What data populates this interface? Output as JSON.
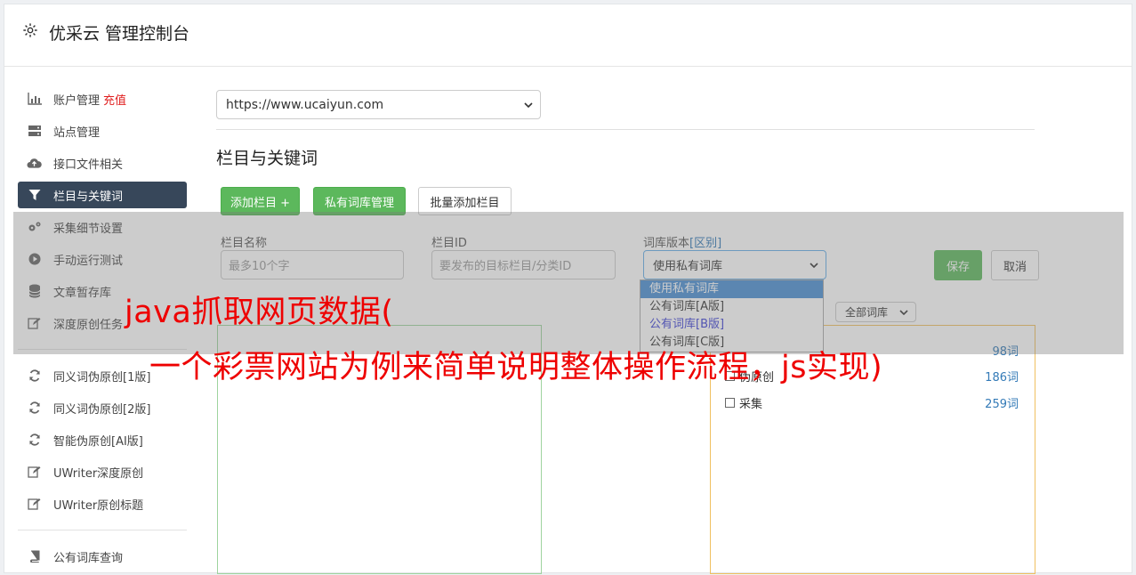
{
  "header": {
    "title": "优采云 管理控制台",
    "icon": "gear-icon"
  },
  "sidebar": {
    "items": [
      {
        "label": "账户管理",
        "badge": "充值",
        "icon": "bar-chart-icon"
      },
      {
        "label": "站点管理",
        "icon": "server-icon"
      },
      {
        "label": "接口文件相关",
        "icon": "cloud-upload-icon"
      },
      {
        "label": "栏目与关键词",
        "icon": "filter-icon",
        "active": true
      },
      {
        "label": "采集细节设置",
        "icon": "cogs-icon"
      },
      {
        "label": "手动运行测试",
        "icon": "play-circle-icon"
      },
      {
        "label": "文章暂存库",
        "icon": "database-icon"
      },
      {
        "label": "深度原创任务",
        "icon": "edit-icon"
      }
    ],
    "items2": [
      {
        "label": "同义词伪原创[1版]",
        "icon": "refresh-icon"
      },
      {
        "label": "同义词伪原创[2版]",
        "icon": "refresh-icon"
      },
      {
        "label": "智能伪原创[AI版]",
        "icon": "refresh-icon"
      },
      {
        "label": "UWriter深度原创",
        "icon": "edit-icon"
      },
      {
        "label": "UWriter原创标题",
        "icon": "edit-icon"
      }
    ],
    "items3": [
      {
        "label": "公有词库查询",
        "icon": "book-icon"
      }
    ]
  },
  "main": {
    "site_select": "https://www.ucaiyun.com",
    "section_title": "栏目与关键词",
    "buttons": {
      "add_column": "添加栏目 +",
      "private_lib": "私有词库管理",
      "batch_add": "批量添加栏目"
    },
    "form": {
      "name_label": "栏目名称",
      "name_placeholder": "最多10个字",
      "id_label": "栏目ID",
      "id_placeholder": "要发布的目标栏目/分类ID",
      "version_label": "词库版本",
      "version_link": "[区别]",
      "version_value": "使用私有词库",
      "save": "保存",
      "cancel": "取消"
    },
    "version_options": [
      "使用私有词库",
      "公有词库[A版]",
      "公有词库[B版]",
      "公有词库[C版]"
    ],
    "all_lib_select": "全部词库",
    "lib_rows": [
      {
        "label": "伪原创",
        "count": "186词"
      },
      {
        "label": "采集",
        "count": "259词"
      }
    ],
    "partial_count": "98词"
  },
  "caption": {
    "line1": "java抓取网页数据(",
    "line2": "一个彩票网站为例来简单说明整体操作流程，js实现)"
  },
  "colors": {
    "accent": "#5cb85c",
    "active_nav": "#37475a",
    "caption": "#ee0000",
    "link": "#337ab7"
  }
}
